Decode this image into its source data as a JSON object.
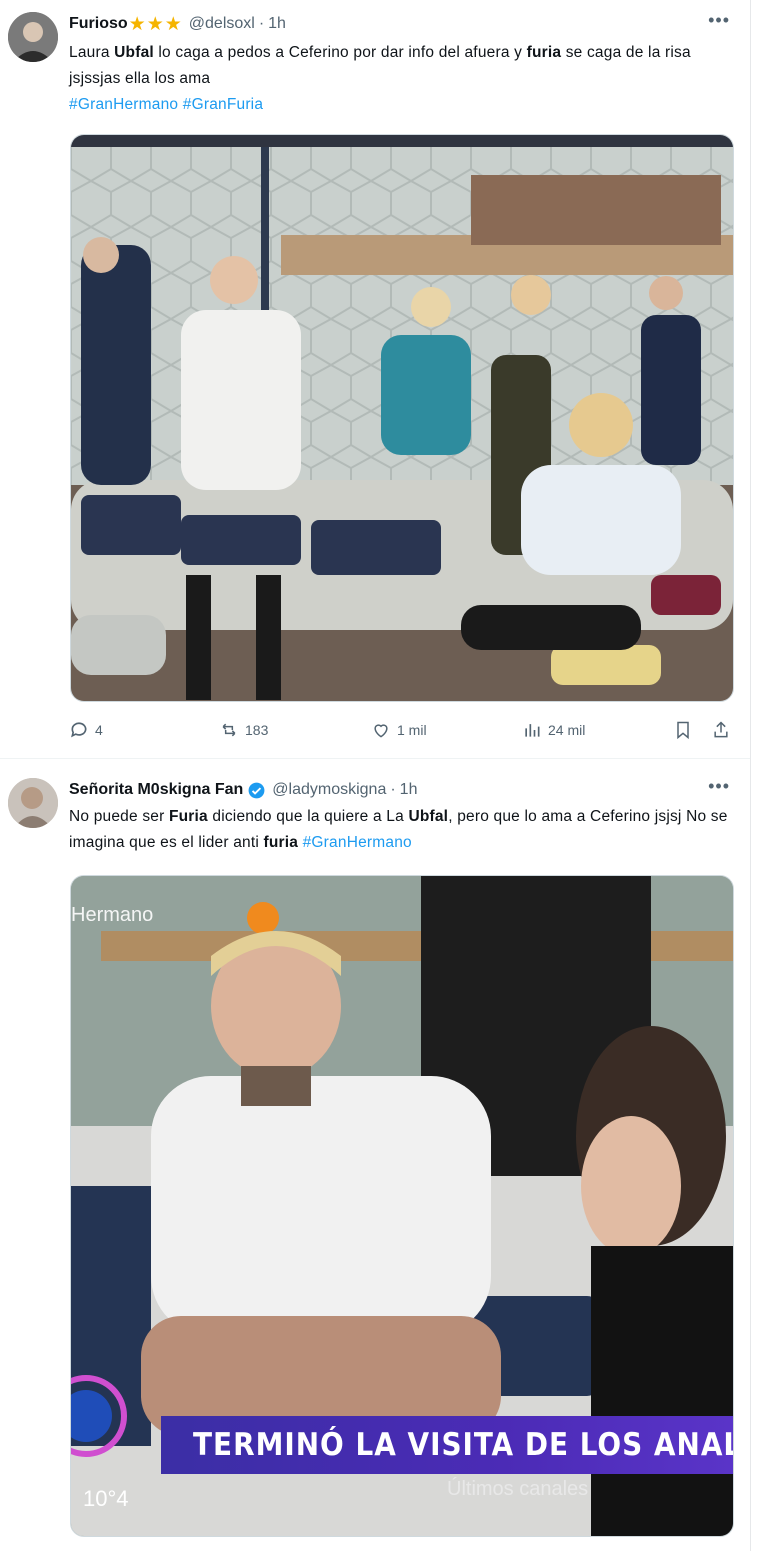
{
  "tweets": [
    {
      "author_name": "Furioso",
      "author_badge": "★★★",
      "handle": "@delsoxl",
      "time": "1h",
      "text_parts": [
        "Laura ",
        "Ubfal",
        " lo caga a pedos a Ceferino por dar info del afuera y ",
        "furia",
        " se caga de la risa jsjssjas ella los ama"
      ],
      "hashtags": [
        "#GranHermano",
        "#GranFuria"
      ],
      "more_label": "•••",
      "actions": {
        "replies": "4",
        "retweets": "183",
        "likes": "1 mil",
        "views": "24 mil"
      }
    },
    {
      "author_name": "Señorita M0skigna Fan",
      "handle": "@ladymoskigna",
      "time": "1h",
      "text_parts": [
        "No puede ser ",
        "Furia",
        " diciendo que la quiere a La ",
        "Ubfal",
        ", pero que lo ama a Ceferino jsjsj No se imagina que es el lider anti ",
        "furia"
      ],
      "hashtags": [
        "#GranHermano"
      ],
      "more_label": "•••",
      "overlay": {
        "watermark": "Hermano",
        "lower_third": "TERMINÓ LA VISITA DE LOS ANALISTAS: LA",
        "ticker": "Últimos canales",
        "clock": "10°4"
      }
    }
  ],
  "colors": {
    "accent": "#1d9bf0",
    "muted": "#536471",
    "star": "#f5b400"
  }
}
